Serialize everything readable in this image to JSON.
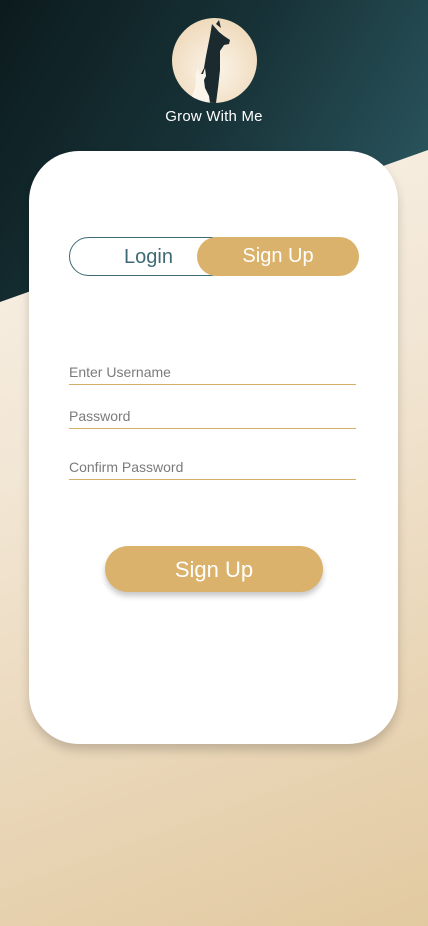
{
  "brand": {
    "name": "Grow With Me",
    "logo_icon": "pet-silhouette-icon"
  },
  "toggle": {
    "login_label": "Login",
    "signup_label": "Sign Up",
    "active": "signup"
  },
  "form": {
    "username_placeholder": "Enter Username",
    "password_placeholder": "Password",
    "confirm_placeholder": "Confirm Password"
  },
  "cta": {
    "label": "Sign Up"
  },
  "colors": {
    "accent": "#dbb26b",
    "teal": "#3e6b73",
    "dark": "#0c1b1d"
  }
}
